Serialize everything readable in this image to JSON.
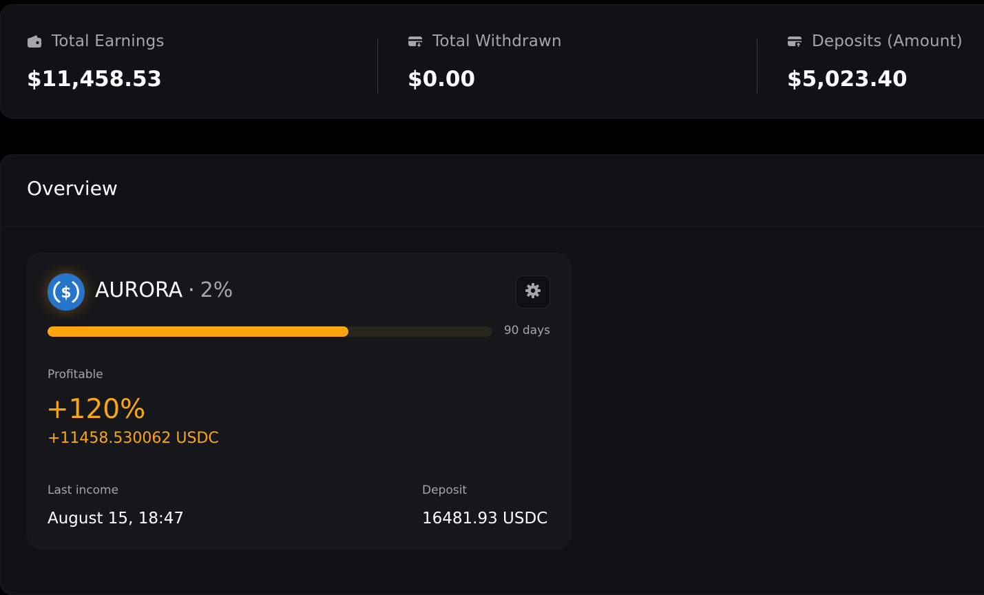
{
  "stats": [
    {
      "label": "Total Earnings",
      "value": "$11,458.53",
      "icon": "wallet-icon"
    },
    {
      "label": "Total Withdrawn",
      "value": "$0.00",
      "icon": "card-withdraw-icon"
    },
    {
      "label": "Deposits (Amount)",
      "value": "$5,023.40",
      "icon": "card-deposit-icon"
    }
  ],
  "overview": {
    "title": "Overview"
  },
  "plan": {
    "coin_icon": "usdc-icon",
    "name": "AURORA",
    "separator": "·",
    "rate": "2%",
    "progress_fraction": 0.677,
    "duration": "90 days",
    "profitable_label": "Profitable",
    "profit_percent": "+120%",
    "profit_amount": "+11458.530062 USDC",
    "last_income_label": "Last income",
    "last_income_value": "August 15, 18:47",
    "deposit_label": "Deposit",
    "deposit_value": "16481.93 USDC"
  },
  "colors": {
    "accent": "#fca60e",
    "panel_bg": "#111215",
    "card_bg": "#16171b",
    "muted_text": "#a3a6ad",
    "usdc_blue": "#2775ca"
  }
}
